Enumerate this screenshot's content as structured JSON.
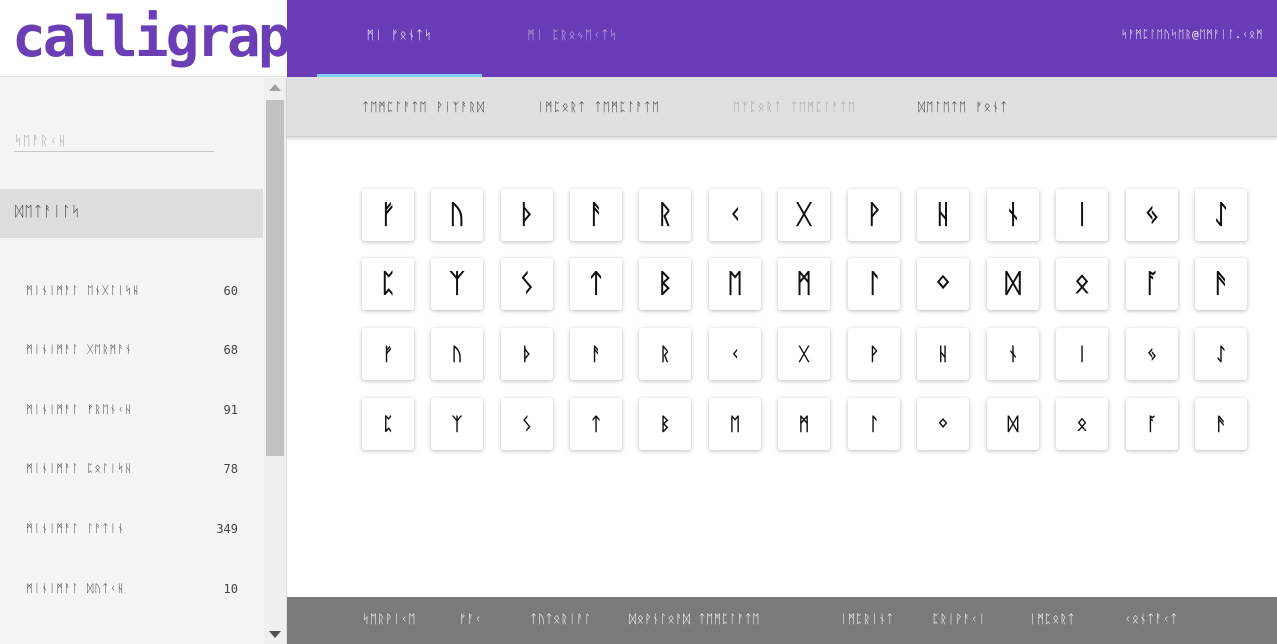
{
  "brand": {
    "logo_text": "calligraphr",
    "color": "#6a3bb6"
  },
  "topbar": {
    "tabs": [
      {
        "label": "ᛗᛁ ᚠᛟᚾᛏᛋ"
      },
      {
        "label": "ᛗᛁ ᛈᚱᛟᛃᛖᚲᛏᛋ"
      }
    ],
    "user_email": "ᛋᚨᛗᛈᛚᛖᚢᛋᛖᚱ@ᛖᛗᚨᛁᛚ.ᚲᛟᛗ"
  },
  "subtabs": [
    {
      "label": "ᛏᛖᛗᛈᛚᚨᛏᛖ ᚹᛁᛉᚨᚱᛞ",
      "disabled": false
    },
    {
      "label": "ᛁᛗᛈᛟᚱᛏ ᛏᛖᛗᛈᛚᚨᛏᛖ",
      "disabled": false
    },
    {
      "label": "ᛖᛉᛈᛟᚱᛏ ᛏᛖᛗᛈᛚᚨᛏᛖ",
      "disabled": true
    },
    {
      "label": "ᛞᛖᛚᛖᛏᛖ ᚠᛟᚾᛏ",
      "disabled": false
    }
  ],
  "sidebar": {
    "search_placeholder": "ᛋᛖᚨᚱᚲᚺ",
    "section_title": "ᛞᛖᛏᚨᛁᛚᛋ",
    "items": [
      {
        "label": "ᛗᛁᚾᛁᛗᚨᛚ ᛖᚾᚷᛚᛁᛋᚺ",
        "count": "60"
      },
      {
        "label": "ᛗᛁᚾᛁᛗᚨᛚ ᚷᛖᚱᛗᚨᚾ",
        "count": "68"
      },
      {
        "label": "ᛗᛁᚾᛁᛗᚨᛚ ᚠᚱᛖᚾᚲᚺ",
        "count": "91"
      },
      {
        "label": "ᛗᛁᚾᛁᛗᚨᛚ ᛈᛟᛚᛁᛋᚺ",
        "count": "78"
      },
      {
        "label": "ᛗᛁᚾᛁᛗᚨᛚ ᛚᚨᛏᛁᚾ",
        "count": "349"
      },
      {
        "label": "ᛗᛁᚾᛁᛗᚨᛚ ᛞᚢᛏᚲᚺ",
        "count": "10"
      }
    ]
  },
  "glyph_rows": [
    [
      "ᚠ",
      "ᚢ",
      "ᚦ",
      "ᚨ",
      "ᚱ",
      "ᚲ",
      "ᚷ",
      "ᚹ",
      "ᚺ",
      "ᚾ",
      "ᛁ",
      "ᛃ",
      "ᛇ"
    ],
    [
      "ᛈ",
      "ᛉ",
      "ᛊ",
      "ᛏ",
      "ᛒ",
      "ᛖ",
      "ᛗ",
      "ᛚ",
      "ᛜ",
      "ᛞ",
      "ᛟ",
      "ᚪ",
      "ᚫ"
    ],
    [
      "ᚠ",
      "ᚢ",
      "ᚦ",
      "ᚨ",
      "ᚱ",
      "ᚲ",
      "ᚷ",
      "ᚹ",
      "ᚺ",
      "ᚾ",
      "ᛁ",
      "ᛃ",
      "ᛇ"
    ],
    [
      "ᛈ",
      "ᛉ",
      "ᛊ",
      "ᛏ",
      "ᛒ",
      "ᛖ",
      "ᛗ",
      "ᛚ",
      "ᛜ",
      "ᛞ",
      "ᛟ",
      "ᚪ",
      "ᚫ"
    ]
  ],
  "footer": {
    "left_links": [
      "ᛋᛖᚱᚹᛁᚲᛖ",
      "ᚠᚨᚲ",
      "ᛏᚢᛏᛟᚱᛁᚨᛚ",
      "ᛞᛟᚹᚾᛚᛟᚨᛞ ᛏᛖᛗᛈᛚᚨᛏᛖ"
    ],
    "right_links": [
      "ᛁᛗᛈᚱᛁᚾᛏ",
      "ᛈᚱᛁᚹᚨᚲᛁ",
      "ᛁᛗᛈᛟᚱᛏ",
      "ᚲᛟᚾᛏᚨᚲᛏ"
    ]
  }
}
